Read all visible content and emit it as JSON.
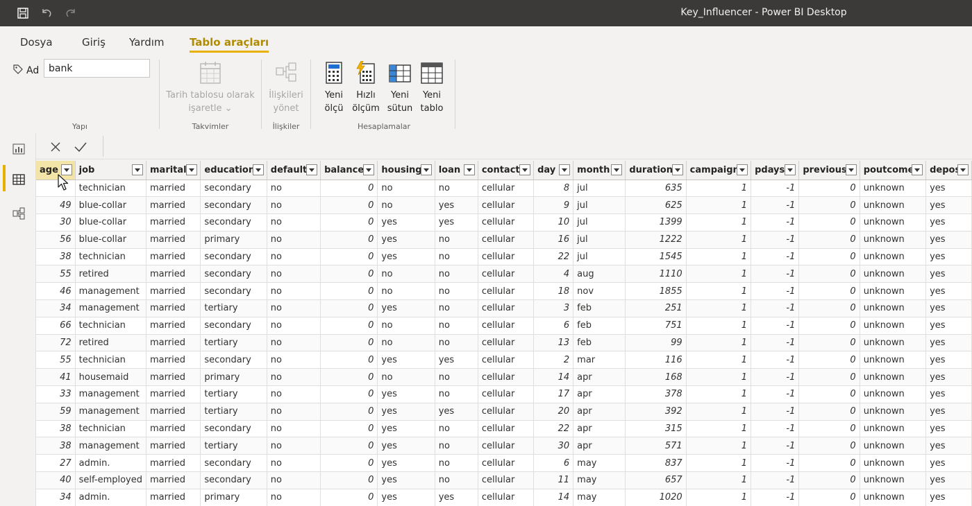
{
  "window": {
    "title": "Key_Influencer - Power BI Desktop"
  },
  "tabs": [
    {
      "label": "Dosya"
    },
    {
      "label": "Giriş"
    },
    {
      "label": "Yardım"
    },
    {
      "label": "Tablo araçları"
    }
  ],
  "ribbon": {
    "name_label": "Ad",
    "name_value": "bank",
    "group_structure": "Yapı",
    "date_table_btn_line1": "Tarih tablosu olarak",
    "date_table_btn_line2": "işaretle",
    "group_calendars": "Takvimler",
    "relations_btn_line1": "İlişkileri",
    "relations_btn_line2": "yönet",
    "group_relations": "İlişkiler",
    "new_measure_line1": "Yeni",
    "new_measure_line2": "ölçü",
    "quick_measure_line1": "Hızlı",
    "quick_measure_line2": "ölçüm",
    "new_column_line1": "Yeni",
    "new_column_line2": "sütun",
    "new_table_line1": "Yeni",
    "new_table_line2": "tablo",
    "group_calculations": "Hesaplamalar"
  },
  "table": {
    "columns": [
      "age",
      "job",
      "marital",
      "education",
      "default",
      "balance",
      "housing",
      "loan",
      "contact",
      "day",
      "month",
      "duration",
      "campaign",
      "pdays",
      "previous",
      "poutcome",
      "deposit"
    ],
    "numeric": [
      true,
      false,
      false,
      false,
      false,
      true,
      false,
      false,
      false,
      true,
      false,
      true,
      true,
      true,
      true,
      false,
      false
    ],
    "rows": [
      [
        "",
        "technician",
        "married",
        "secondary",
        "no",
        "0",
        "no",
        "no",
        "cellular",
        "8",
        "jul",
        "635",
        "1",
        "-1",
        "0",
        "unknown",
        "yes"
      ],
      [
        "49",
        "blue-collar",
        "married",
        "secondary",
        "no",
        "0",
        "no",
        "yes",
        "cellular",
        "9",
        "jul",
        "625",
        "1",
        "-1",
        "0",
        "unknown",
        "yes"
      ],
      [
        "30",
        "blue-collar",
        "married",
        "secondary",
        "no",
        "0",
        "yes",
        "yes",
        "cellular",
        "10",
        "jul",
        "1399",
        "1",
        "-1",
        "0",
        "unknown",
        "yes"
      ],
      [
        "56",
        "blue-collar",
        "married",
        "primary",
        "no",
        "0",
        "yes",
        "no",
        "cellular",
        "16",
        "jul",
        "1222",
        "1",
        "-1",
        "0",
        "unknown",
        "yes"
      ],
      [
        "38",
        "technician",
        "married",
        "secondary",
        "no",
        "0",
        "yes",
        "no",
        "cellular",
        "22",
        "jul",
        "1545",
        "1",
        "-1",
        "0",
        "unknown",
        "yes"
      ],
      [
        "55",
        "retired",
        "married",
        "secondary",
        "no",
        "0",
        "no",
        "no",
        "cellular",
        "4",
        "aug",
        "1110",
        "1",
        "-1",
        "0",
        "unknown",
        "yes"
      ],
      [
        "46",
        "management",
        "married",
        "secondary",
        "no",
        "0",
        "no",
        "no",
        "cellular",
        "18",
        "nov",
        "1855",
        "1",
        "-1",
        "0",
        "unknown",
        "yes"
      ],
      [
        "34",
        "management",
        "married",
        "tertiary",
        "no",
        "0",
        "yes",
        "no",
        "cellular",
        "3",
        "feb",
        "251",
        "1",
        "-1",
        "0",
        "unknown",
        "yes"
      ],
      [
        "66",
        "technician",
        "married",
        "secondary",
        "no",
        "0",
        "no",
        "no",
        "cellular",
        "6",
        "feb",
        "751",
        "1",
        "-1",
        "0",
        "unknown",
        "yes"
      ],
      [
        "72",
        "retired",
        "married",
        "tertiary",
        "no",
        "0",
        "no",
        "no",
        "cellular",
        "13",
        "feb",
        "99",
        "1",
        "-1",
        "0",
        "unknown",
        "yes"
      ],
      [
        "55",
        "technician",
        "married",
        "secondary",
        "no",
        "0",
        "yes",
        "yes",
        "cellular",
        "2",
        "mar",
        "116",
        "1",
        "-1",
        "0",
        "unknown",
        "yes"
      ],
      [
        "41",
        "housemaid",
        "married",
        "primary",
        "no",
        "0",
        "no",
        "no",
        "cellular",
        "14",
        "apr",
        "168",
        "1",
        "-1",
        "0",
        "unknown",
        "yes"
      ],
      [
        "33",
        "management",
        "married",
        "tertiary",
        "no",
        "0",
        "yes",
        "no",
        "cellular",
        "17",
        "apr",
        "378",
        "1",
        "-1",
        "0",
        "unknown",
        "yes"
      ],
      [
        "59",
        "management",
        "married",
        "tertiary",
        "no",
        "0",
        "yes",
        "yes",
        "cellular",
        "20",
        "apr",
        "392",
        "1",
        "-1",
        "0",
        "unknown",
        "yes"
      ],
      [
        "38",
        "technician",
        "married",
        "secondary",
        "no",
        "0",
        "yes",
        "no",
        "cellular",
        "22",
        "apr",
        "315",
        "1",
        "-1",
        "0",
        "unknown",
        "yes"
      ],
      [
        "38",
        "management",
        "married",
        "tertiary",
        "no",
        "0",
        "yes",
        "no",
        "cellular",
        "30",
        "apr",
        "571",
        "1",
        "-1",
        "0",
        "unknown",
        "yes"
      ],
      [
        "27",
        "admin.",
        "married",
        "secondary",
        "no",
        "0",
        "yes",
        "no",
        "cellular",
        "6",
        "may",
        "837",
        "1",
        "-1",
        "0",
        "unknown",
        "yes"
      ],
      [
        "40",
        "self-employed",
        "married",
        "secondary",
        "no",
        "0",
        "yes",
        "no",
        "cellular",
        "11",
        "may",
        "657",
        "1",
        "-1",
        "0",
        "unknown",
        "yes"
      ],
      [
        "34",
        "admin.",
        "married",
        "primary",
        "no",
        "0",
        "yes",
        "yes",
        "cellular",
        "14",
        "may",
        "1020",
        "1",
        "-1",
        "0",
        "unknown",
        "yes"
      ]
    ]
  },
  "colors": {
    "accent": "#e8b000",
    "titlebar": "#3b3a39"
  }
}
